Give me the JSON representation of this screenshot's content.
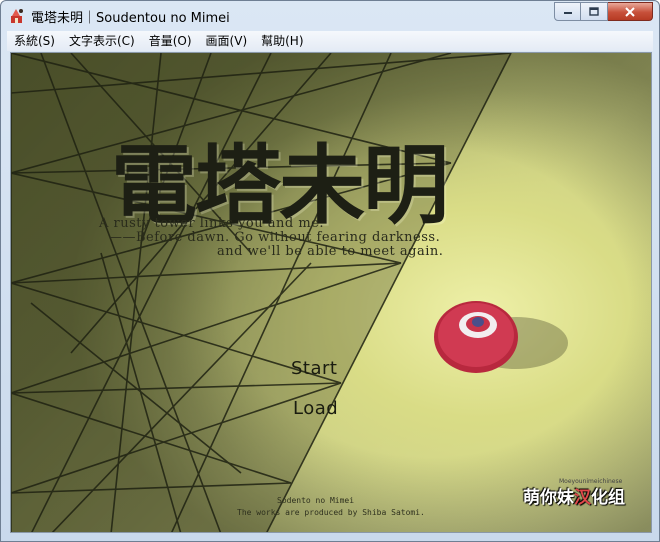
{
  "window": {
    "title": "電塔未明｜Soudentou no Mimei"
  },
  "menubar": {
    "items": [
      {
        "label": "系統(S)"
      },
      {
        "label": "文字表示(C)"
      },
      {
        "label": "音量(O)"
      },
      {
        "label": "画面(V)"
      },
      {
        "label": "幫助(H)"
      }
    ]
  },
  "game": {
    "logo": "電塔未明",
    "tagline": [
      "A rusty tower links you and me.",
      "——Before dawn. Go without fearing darkness.",
      "and we'll be able to meet again."
    ],
    "menu": {
      "start": "Start",
      "load": "Load"
    },
    "credits": [
      "Sodento no Mimei",
      "The works are produced by Shiba Satomi."
    ],
    "group_logo": {
      "before": "萌你妹",
      "accent": "汉",
      "after": "化组",
      "sub": "Moeyounimeichinese"
    }
  },
  "icons": {
    "app": "app-icon",
    "minimize": "minimize-icon",
    "maximize": "maximize-icon",
    "close": "close-icon"
  }
}
